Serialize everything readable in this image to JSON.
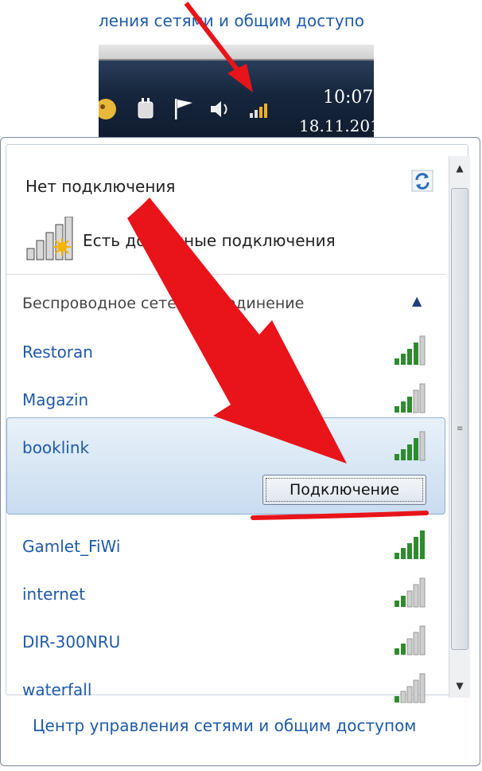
{
  "top": {
    "link_text": "ления сетями и общим доступо",
    "clock_time": "10:07",
    "clock_date": "18.11.201"
  },
  "popup": {
    "status_title": "Нет подключения",
    "connect_status": "Есть доступные подключения",
    "section_title": "Беспроводное сетевое соединение",
    "networks": [
      {
        "name": "Restoran"
      },
      {
        "name": "Magazin"
      },
      {
        "name": "booklink"
      },
      {
        "name": "Gamlet_FiWi"
      },
      {
        "name": "internet"
      },
      {
        "name": "DIR-300NRU"
      },
      {
        "name": "waterfall"
      }
    ],
    "connect_button": "Подключение",
    "footer_link": "Центр управления сетями и общим доступом"
  },
  "colors": {
    "link": "#1e5aa8",
    "annotation_red": "#e8141a",
    "signal_green": "#2e8b2e"
  },
  "icons": {
    "refresh": "refresh-icon",
    "signal": "wifi-signal-icon",
    "tray": [
      "app-icon",
      "power-plug-icon",
      "flag-icon",
      "speaker-icon",
      "network-icon"
    ]
  }
}
